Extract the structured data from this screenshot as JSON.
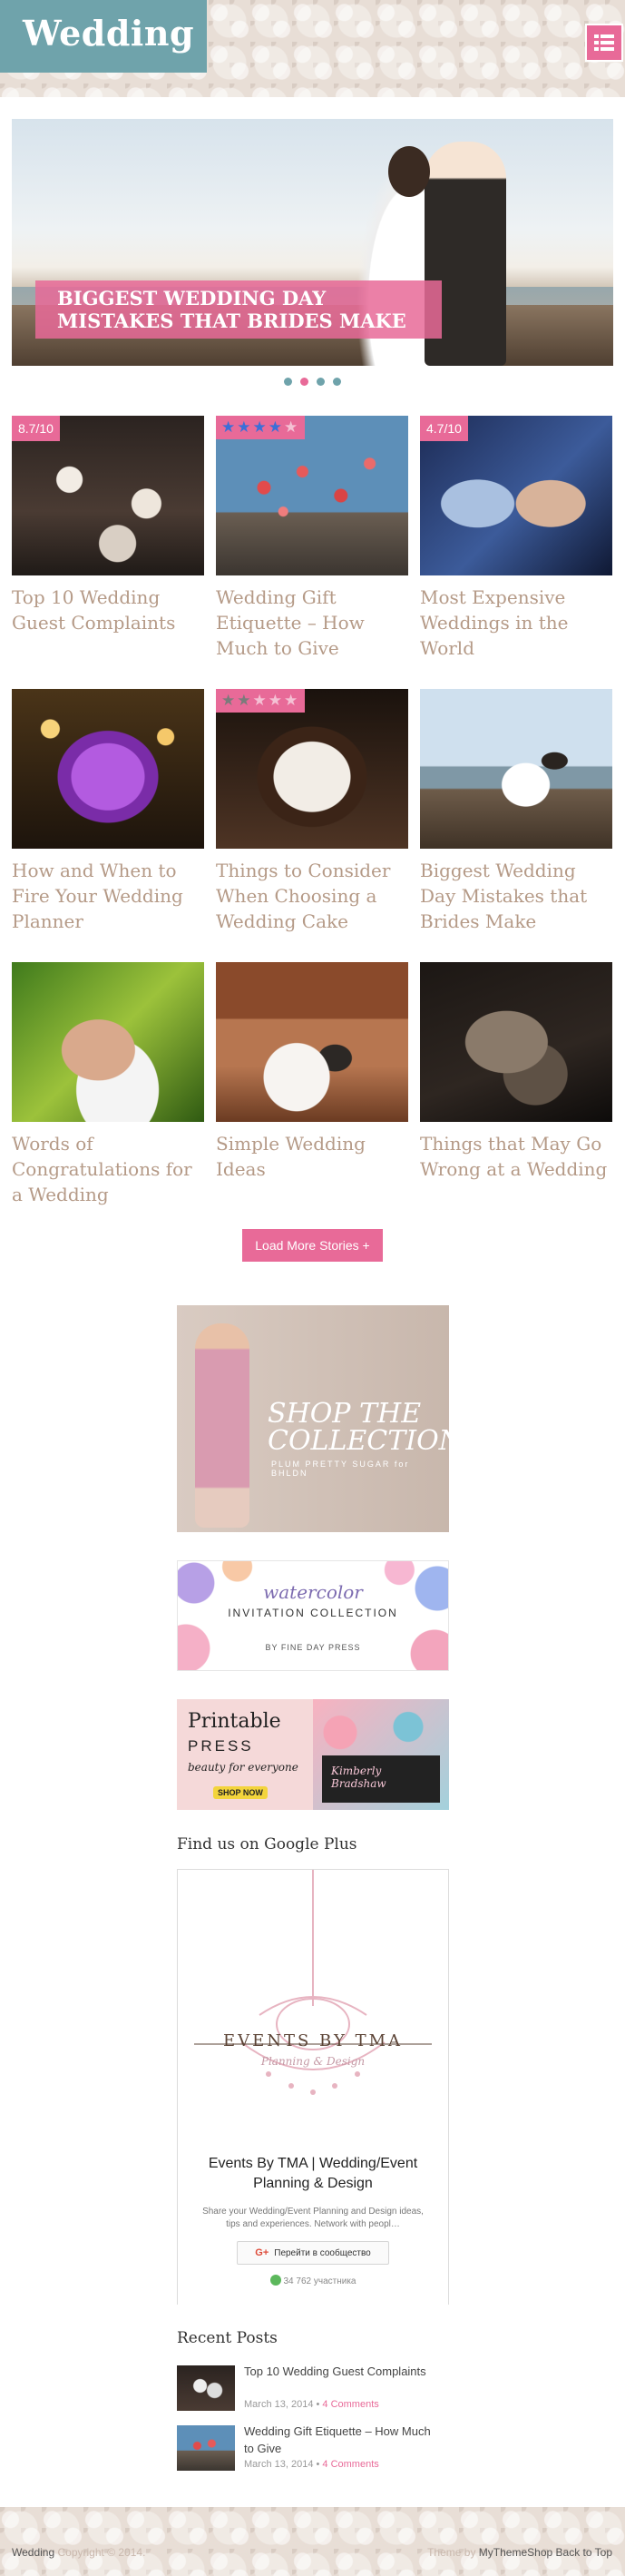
{
  "header": {
    "logo": "Wedding",
    "menu_icon": "list-menu-icon"
  },
  "slider": {
    "caption": "BIGGEST WEDDING DAY MISTAKES THAT BRIDES MAKE",
    "dot_count": 4,
    "active_dot": 2
  },
  "posts": [
    {
      "title": "Top 10 Wedding Guest Complaints",
      "badge": "8.7/10",
      "badge_type": "score"
    },
    {
      "title": "Wedding Gift Etiquette – How Much to Give",
      "badge": "",
      "badge_type": "stars",
      "stars": 4
    },
    {
      "title": "Most Expensive Weddings in the World",
      "badge": "4.7/10",
      "badge_type": "score"
    },
    {
      "title": "How and When to Fire Your Wedding Planner",
      "badge": "",
      "badge_type": "none"
    },
    {
      "title": "Things to Consider When Choosing a Wedding Cake",
      "badge": "",
      "badge_type": "stars",
      "stars": 2.5
    },
    {
      "title": "Biggest Wedding Day Mistakes that Brides Make",
      "badge": "",
      "badge_type": "none"
    },
    {
      "title": "Words of Congratulations for a Wedding",
      "badge": "",
      "badge_type": "none"
    },
    {
      "title": "Simple Wedding Ideas",
      "badge": "",
      "badge_type": "none"
    },
    {
      "title": "Things that May Go Wrong at a Wedding",
      "badge": "",
      "badge_type": "none"
    }
  ],
  "load_more": "Load More Stories +",
  "ads": {
    "ad1_title": "SHOP THE COLLECTION",
    "ad1_sub": "PLUM PRETTY SUGAR for BHLDN",
    "ad2_title": "watercolor",
    "ad2_sub": "INVITATION COLLECTION",
    "ad2_by": "BY FINE DAY PRESS",
    "ad3_title": "Printable",
    "ad3_press": "PRESS",
    "ad3_tag": "beauty for everyone",
    "ad3_btn": "SHOP NOW",
    "ad3_card": "Kimberly Bradshaw"
  },
  "gplus": {
    "widget_title": "Find us on Google Plus",
    "brand_big": "EVENTS BY TMA",
    "brand_small": "Planning & Design",
    "name": "Events By TMA | Wedding/Event Planning & Design",
    "desc": "Share your Wedding/Event Planning and Design ideas, tips and experiences. Network with peopl…",
    "follow_label": "Перейти в сообщество",
    "count": "34 762 участника"
  },
  "recent": {
    "title": "Recent Posts",
    "items": [
      {
        "title": "Top 10 Wedding Guest Complaints",
        "date": "March 13, 2014",
        "comments": "4 Comments"
      },
      {
        "title": "Wedding Gift Etiquette – How Much to Give",
        "date": "March 13, 2014",
        "comments": "4 Comments"
      }
    ]
  },
  "footer": {
    "site": "Wedding",
    "copyright": "Copyright © 2014.",
    "theme_by": "Theme by",
    "theme_author": "MyThemeShop",
    "back_to_top": "Back to Top"
  },
  "colors": {
    "accent": "#e86a98",
    "teal": "#6fa3ab",
    "title_brown": "#b59a87"
  }
}
